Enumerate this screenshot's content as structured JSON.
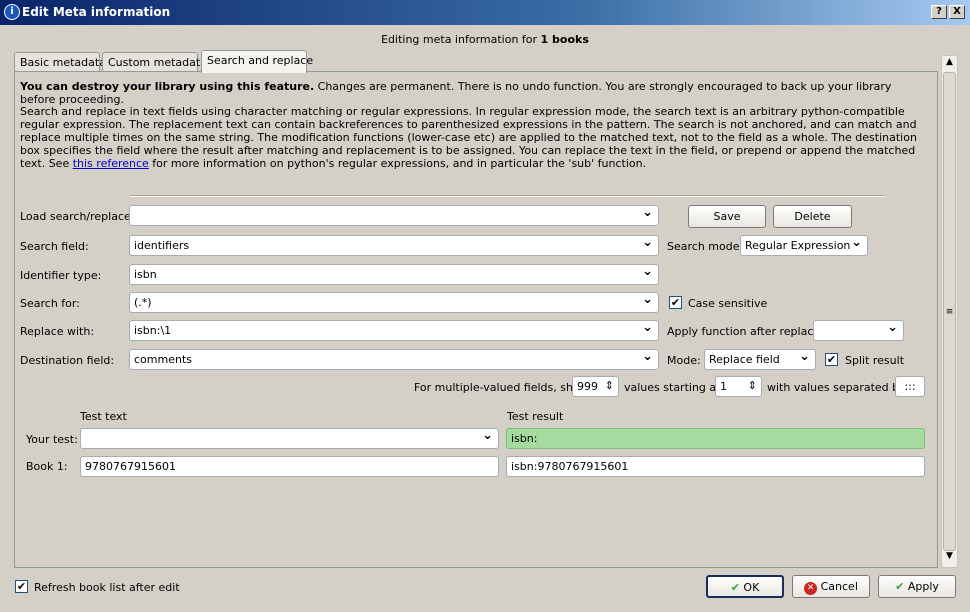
{
  "window": {
    "title": "Edit Meta information",
    "help": "?",
    "close": "X"
  },
  "heading": {
    "prefix": "Editing meta information for ",
    "count": "1 books"
  },
  "tabs": [
    {
      "label": "Basic metadata"
    },
    {
      "label": "Custom metadata"
    },
    {
      "label": "Search and replace"
    }
  ],
  "warning": {
    "bold": "You can destroy your library using this feature.",
    "rest": " Changes are permanent. There is no undo function. You are strongly encouraged to back up your library before proceeding."
  },
  "description": {
    "text": "Search and replace in text fields using character matching or regular expressions. In regular expression mode, the search text is an arbitrary python-compatible regular expression. The replacement text can contain backreferences to parenthesized expressions in the pattern. The search is not anchored, and can match and replace multiple times on the same string. The modification functions (lower-case etc) are applied to the matched text, not to the field as a whole. The destination box specifies the field where the result after matching and replacement is to be assigned. You can replace the text in the field, or prepend or append the matched text. See ",
    "link": "this reference",
    "tail": " for more information on python's regular expressions, and in particular the 'sub' function."
  },
  "form": {
    "load_label": "Load search/replace:",
    "load_value": "",
    "save": "Save",
    "delete": "Delete",
    "search_field_label": "Search field:",
    "search_field": "identifiers",
    "search_mode_label": "Search mode:",
    "search_mode": "Regular Expression",
    "identifier_type_label": "Identifier type:",
    "identifier_type": "isbn",
    "search_for_label": "Search for:",
    "search_for": "(.*)",
    "case_sensitive_label": "Case sensitive",
    "case_sensitive": true,
    "replace_with_label": "Replace with:",
    "replace_with": "isbn:\\1",
    "apply_function_label": "Apply function after replace:",
    "apply_function": "",
    "destination_label": "Destination field:",
    "destination": "comments",
    "mode_label": "Mode:",
    "mode": "Replace field",
    "split_result_label": "Split result",
    "split_result": true,
    "multi_label": "For multiple-valued fields, show",
    "multi_show": "999",
    "starting_label": "values starting at",
    "starting_at": "1",
    "separated_label": "with values separated by",
    "separator": ":::"
  },
  "test": {
    "test_text_header": "Test text",
    "test_result_header": "Test result",
    "your_test_label": "Your test:",
    "your_test_value": "",
    "your_test_result": "isbn:",
    "book1_label": "Book 1:",
    "book1_text": "9780767915601",
    "book1_result": "isbn:9780767915601"
  },
  "footer": {
    "refresh_label": "Refresh book list after edit",
    "refresh": true,
    "ok": "OK",
    "cancel": "Cancel",
    "apply": "Apply"
  },
  "colors": {
    "result_ok": "#a6dba0"
  }
}
